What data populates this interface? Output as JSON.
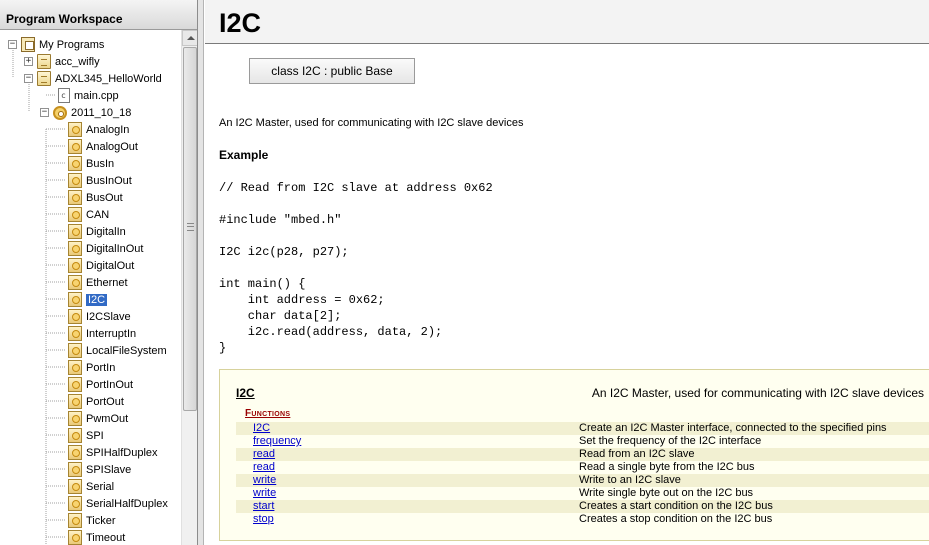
{
  "left_panel": {
    "title": "Program Workspace",
    "tree": [
      {
        "label": "My Programs",
        "icon": "programs-icon",
        "expander": "−",
        "indent": 0
      },
      {
        "label": "acc_wifly",
        "icon": "program-icon",
        "expander": "+",
        "indent": 1
      },
      {
        "label": "ADXL345_HelloWorld",
        "icon": "program-icon",
        "expander": "−",
        "indent": 1
      },
      {
        "label": "main.cpp",
        "icon": "cpp-file-icon",
        "expander": "",
        "indent": 2
      },
      {
        "label": "2011_10_18",
        "icon": "gear-library-icon",
        "expander": "−",
        "indent": 2
      },
      {
        "label": "AnalogIn",
        "icon": "class-icon",
        "expander": "",
        "indent": 3
      },
      {
        "label": "AnalogOut",
        "icon": "class-icon",
        "expander": "",
        "indent": 3
      },
      {
        "label": "BusIn",
        "icon": "class-icon",
        "expander": "",
        "indent": 3
      },
      {
        "label": "BusInOut",
        "icon": "class-icon",
        "expander": "",
        "indent": 3
      },
      {
        "label": "BusOut",
        "icon": "class-icon",
        "expander": "",
        "indent": 3
      },
      {
        "label": "CAN",
        "icon": "class-icon",
        "expander": "",
        "indent": 3
      },
      {
        "label": "DigitalIn",
        "icon": "class-icon",
        "expander": "",
        "indent": 3
      },
      {
        "label": "DigitalInOut",
        "icon": "class-icon",
        "expander": "",
        "indent": 3
      },
      {
        "label": "DigitalOut",
        "icon": "class-icon",
        "expander": "",
        "indent": 3
      },
      {
        "label": "Ethernet",
        "icon": "class-icon",
        "expander": "",
        "indent": 3
      },
      {
        "label": "I2C",
        "icon": "class-icon",
        "expander": "",
        "indent": 3,
        "selected": true
      },
      {
        "label": "I2CSlave",
        "icon": "class-icon",
        "expander": "",
        "indent": 3
      },
      {
        "label": "InterruptIn",
        "icon": "class-icon",
        "expander": "",
        "indent": 3
      },
      {
        "label": "LocalFileSystem",
        "icon": "class-icon",
        "expander": "",
        "indent": 3
      },
      {
        "label": "PortIn",
        "icon": "class-icon",
        "expander": "",
        "indent": 3
      },
      {
        "label": "PortInOut",
        "icon": "class-icon",
        "expander": "",
        "indent": 3
      },
      {
        "label": "PortOut",
        "icon": "class-icon",
        "expander": "",
        "indent": 3
      },
      {
        "label": "PwmOut",
        "icon": "class-icon",
        "expander": "",
        "indent": 3
      },
      {
        "label": "SPI",
        "icon": "class-icon",
        "expander": "",
        "indent": 3
      },
      {
        "label": "SPIHalfDuplex",
        "icon": "class-icon",
        "expander": "",
        "indent": 3
      },
      {
        "label": "SPISlave",
        "icon": "class-icon",
        "expander": "",
        "indent": 3
      },
      {
        "label": "Serial",
        "icon": "class-icon",
        "expander": "",
        "indent": 3
      },
      {
        "label": "SerialHalfDuplex",
        "icon": "class-icon",
        "expander": "",
        "indent": 3
      },
      {
        "label": "Ticker",
        "icon": "class-icon",
        "expander": "",
        "indent": 3
      },
      {
        "label": "Timeout",
        "icon": "class-icon",
        "expander": "",
        "indent": 3
      }
    ]
  },
  "content": {
    "title": "I2C",
    "class_button": "class I2C : public Base",
    "description": "An I2C Master, used for communicating with I2C slave devices",
    "example_heading": "Example",
    "code": "// Read from I2C slave at address 0x62\n\n#include \"mbed.h\"\n\nI2C i2c(p28, p27);\n\nint main() {\n    int address = 0x62;\n    char data[2];\n    i2c.read(address, data, 2);\n}",
    "members": {
      "title": "I2C",
      "summary": "An I2C Master, used for communicating with I2C slave devices",
      "functions_heading": "Functions",
      "functions": [
        {
          "name": "I2C",
          "desc": "Create an I2C Master interface, connected to the specified pins"
        },
        {
          "name": "frequency",
          "desc": "Set the frequency of the I2C interface"
        },
        {
          "name": "read",
          "desc": "Read from an I2C slave"
        },
        {
          "name": "read",
          "desc": "Read a single byte from the I2C bus"
        },
        {
          "name": "write",
          "desc": "Write to an I2C slave"
        },
        {
          "name": "write",
          "desc": "Write single byte out on the I2C bus"
        },
        {
          "name": "start",
          "desc": "Creates a start condition on the I2C bus"
        },
        {
          "name": "stop",
          "desc": "Creates a stop condition on the I2C bus"
        }
      ]
    }
  },
  "colors": {
    "selection": "#316ac5",
    "link": "#0000cc",
    "functions_heading": "#990000",
    "members_background": "#fffff0"
  }
}
